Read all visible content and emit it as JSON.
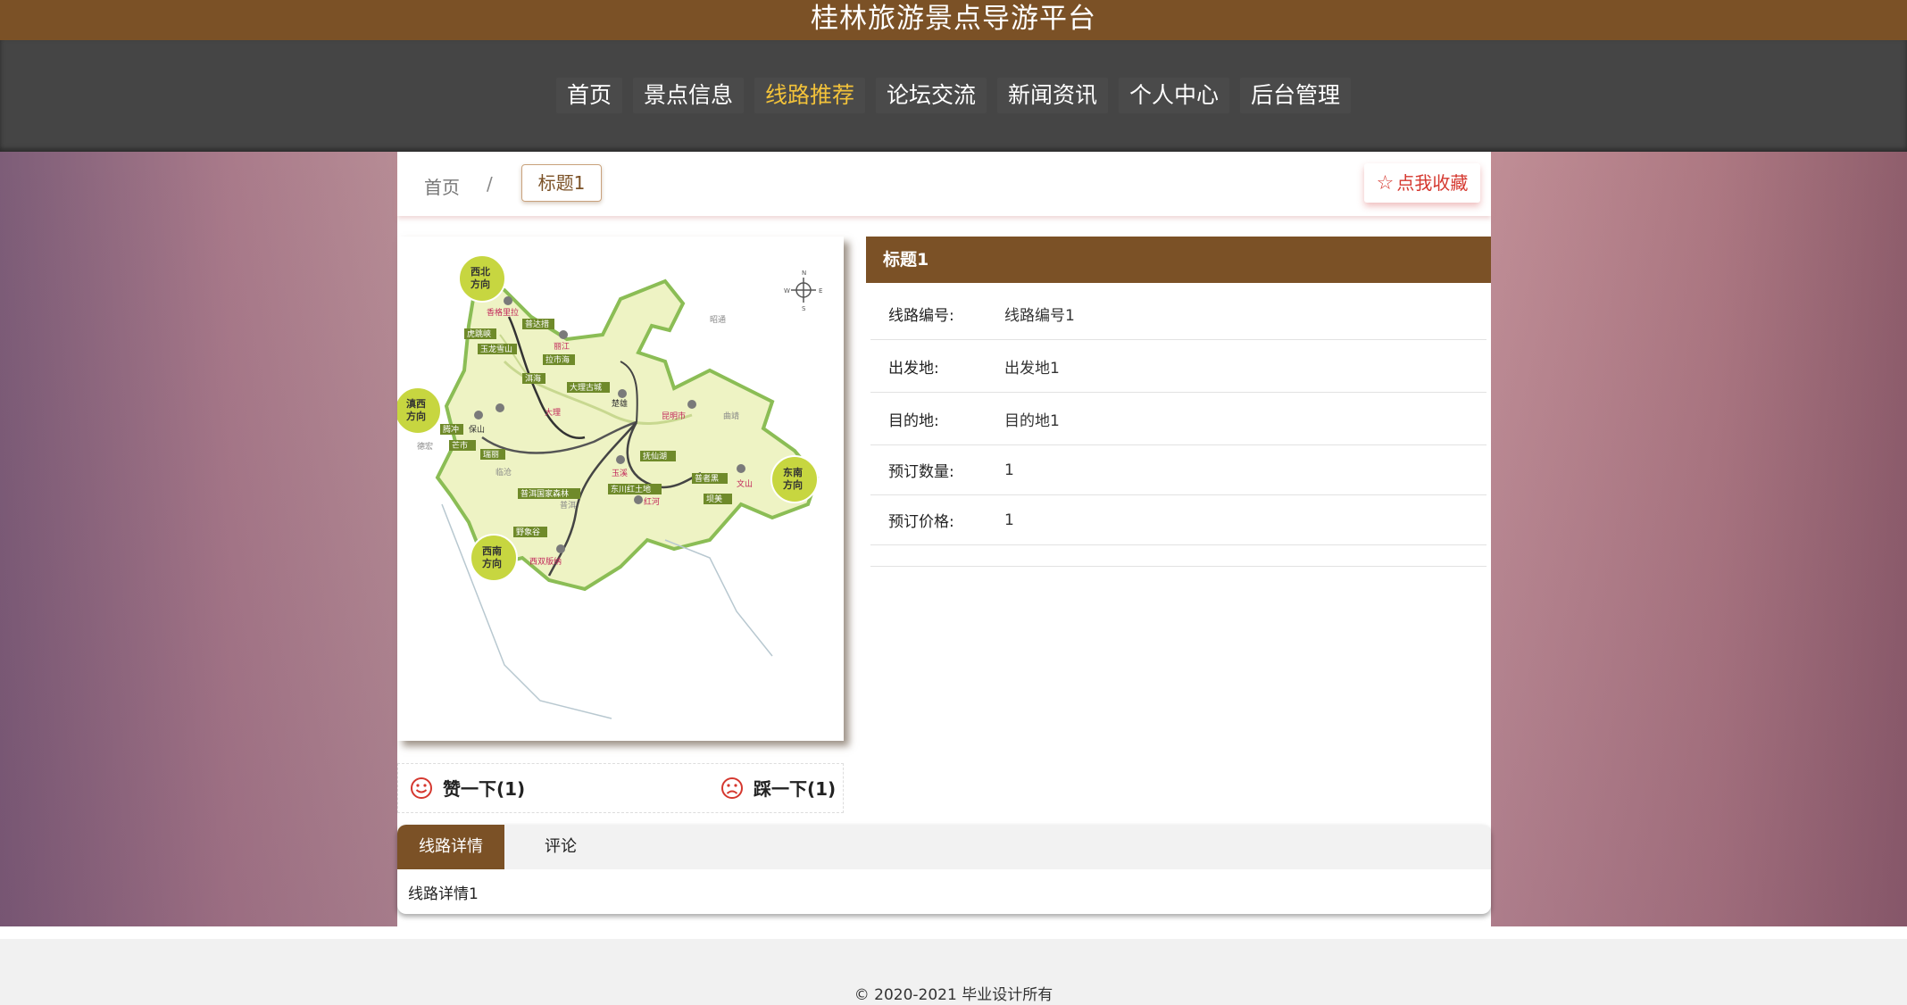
{
  "header": {
    "title": "桂林旅游景点导游平台"
  },
  "nav": {
    "items": [
      {
        "label": "首页"
      },
      {
        "label": "景点信息"
      },
      {
        "label": "线路推荐"
      },
      {
        "label": "论坛交流"
      },
      {
        "label": "新闻资讯"
      },
      {
        "label": "个人中心"
      },
      {
        "label": "后台管理"
      }
    ],
    "active_index": 2
  },
  "breadcrumb": {
    "home": "首页",
    "separator": "/",
    "current": "标题1"
  },
  "favorite": {
    "icon": "star-outline-icon",
    "label": "点我收藏"
  },
  "map": {
    "directions": [
      "西北方向",
      "滇西方向",
      "东南方向",
      "西南方向"
    ],
    "places": [
      "香格里拉",
      "普达措",
      "丽江",
      "虎跳峡",
      "玉龙雪山",
      "拉市海",
      "洱海",
      "大理古城",
      "大理",
      "楚雄",
      "昆明市",
      "曲靖",
      "昭通",
      "腾冲",
      "保山",
      "芒市",
      "德宏",
      "瑞丽",
      "临沧",
      "抚仙湖",
      "玉溪",
      "普者黑",
      "文山",
      "东川红土地",
      "红河",
      "坝美",
      "普洱国家森林",
      "普洱",
      "野象谷",
      "西双版纳"
    ]
  },
  "votes": {
    "like": {
      "icon": "smile-icon",
      "label": "赞一下(1)"
    },
    "dislike": {
      "icon": "frown-icon",
      "label": "踩一下(1)"
    }
  },
  "route": {
    "title": "标题1",
    "fields": [
      {
        "label": "线路编号:",
        "value": "线路编号1"
      },
      {
        "label": "出发地:",
        "value": "出发地1"
      },
      {
        "label": "目的地:",
        "value": "目的地1"
      },
      {
        "label": "预订数量:",
        "value": "1"
      },
      {
        "label": "预订价格:",
        "value": "1"
      }
    ]
  },
  "tabs": {
    "items": [
      {
        "label": "线路详情"
      },
      {
        "label": "评论"
      }
    ],
    "content": "线路详情1"
  },
  "footer": {
    "text": "© 2020-2021 毕业设计所有"
  },
  "colors": {
    "brand_brown": "#7b5126",
    "nav_bg": "#454545",
    "active_nav": "#f2c23a",
    "favorite_red": "#d5382f"
  }
}
